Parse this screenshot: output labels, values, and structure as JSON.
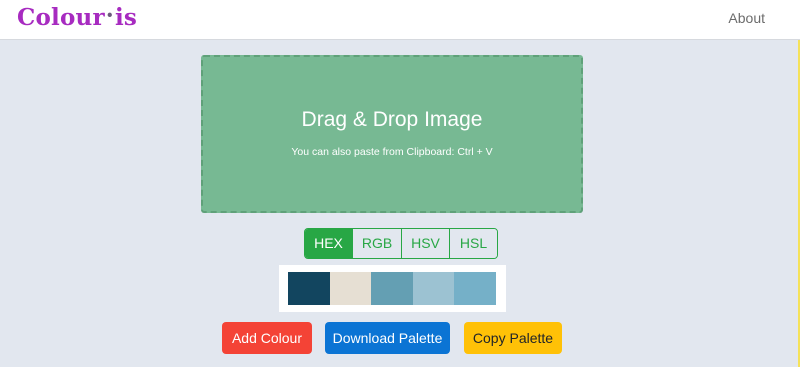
{
  "header": {
    "brand_left": "Colour",
    "brand_dot": "·",
    "brand_right": "is",
    "about_link": "About"
  },
  "dropzone": {
    "title": "Drag & Drop Image",
    "subtitle": "You can also paste from Clipboard: Ctrl + V"
  },
  "formats": [
    {
      "label": "HEX",
      "active": true
    },
    {
      "label": "RGB",
      "active": false
    },
    {
      "label": "HSV",
      "active": false
    },
    {
      "label": "HSL",
      "active": false
    }
  ],
  "palette": [
    "#12455f",
    "#e6dfd3",
    "#649fb3",
    "#9cc2d2",
    "#75b0c8"
  ],
  "actions": {
    "add": "Add Colour",
    "download": "Download Palette",
    "copy": "Copy Palette"
  },
  "colors": {
    "brand": "#a72bc0",
    "dropzone": "#77b993",
    "active_format": "#28a745",
    "add_button": "#f44336",
    "download_button": "#0b74d4",
    "copy_button": "#ffc107",
    "page_background": "#e2e7ef"
  }
}
